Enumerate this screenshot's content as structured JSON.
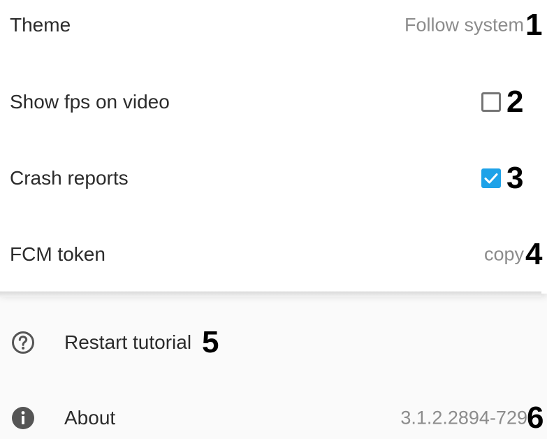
{
  "settings": {
    "theme": {
      "label": "Theme",
      "value": "Follow system",
      "marker": "1"
    },
    "fps": {
      "label": "Show fps on video",
      "checked": false,
      "marker": "2"
    },
    "crash": {
      "label": "Crash reports",
      "checked": true,
      "marker": "3"
    },
    "fcm": {
      "label": "FCM token",
      "value": "copy",
      "marker": "4"
    }
  },
  "extras": {
    "tutorial": {
      "label": "Restart tutorial",
      "icon": "help-circle-icon",
      "marker": "5"
    },
    "about": {
      "label": "About",
      "value": "3.1.2.2894-729",
      "icon": "info-icon",
      "marker": "6"
    }
  },
  "colors": {
    "accent": "#1ea2e8",
    "icon": "#555555"
  }
}
